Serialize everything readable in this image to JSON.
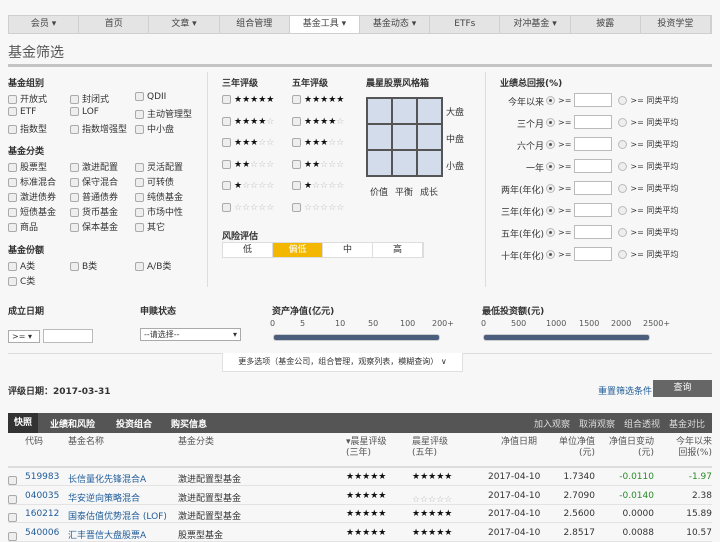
{
  "nav": {
    "items": [
      "会员 ▾",
      "首页",
      "文章 ▾",
      "组合管理",
      "基金工具 ▾",
      "基金动态 ▾",
      "ETFs",
      "对冲基金 ▾",
      "披露",
      "投资学堂"
    ],
    "active": 4
  },
  "page_title": "基金筛选",
  "fund_group": {
    "title": "基金组别",
    "items": [
      "开放式",
      "封闭式",
      "QDII",
      "ETF",
      "LOF",
      "主动管理型",
      "指数型",
      "指数增强型",
      "中小盘"
    ]
  },
  "fund_category": {
    "title": "基金分类",
    "items": [
      "股票型",
      "激进配置",
      "灵活配置",
      "标准混合",
      "保守混合",
      "可转债",
      "激进债券",
      "普通债券",
      "纯债基金",
      "短债基金",
      "货币基金",
      "市场中性",
      "商品",
      "保本基金",
      "其它"
    ]
  },
  "fund_share": {
    "title": "基金份额",
    "items": [
      "A类",
      "B类",
      "A/B类",
      "C类"
    ]
  },
  "rating3": {
    "title": "三年评级",
    "ratings": [
      5,
      4,
      3,
      2,
      1,
      0
    ]
  },
  "rating5": {
    "title": "五年评级",
    "ratings": [
      5,
      4,
      3,
      2,
      1,
      0
    ]
  },
  "stylebox": {
    "title": "晨星股票风格箱",
    "rows": [
      "大盘",
      "中盘",
      "小盘"
    ],
    "cols": [
      "价值",
      "平衡",
      "成长"
    ]
  },
  "risk": {
    "title": "风险评估",
    "options": [
      "低",
      "偏低",
      "中",
      "高"
    ],
    "selected": 1
  },
  "returns": {
    "title": "业绩总回报(%)",
    "op": ">=",
    "avg": ">= 同类平均",
    "rows": [
      "今年以来",
      "三个月",
      "六个月",
      "一年",
      "两年(年化)",
      "三年(年化)",
      "五年(年化)",
      "十年(年化)"
    ]
  },
  "inception": {
    "title": "成立日期",
    "op": ">= ▾",
    "value": ""
  },
  "purchase": {
    "title": "申赎状态",
    "value": "--请选择--"
  },
  "nav_size": {
    "title": "资产净值(亿元)",
    "ticks": [
      "0",
      "5",
      "10",
      "50",
      "100",
      "200+"
    ],
    "range": [
      "0",
      "200+"
    ]
  },
  "min_invest": {
    "title": "最低投资额(元)",
    "ticks": [
      "0",
      "500",
      "1000",
      "1500",
      "2000",
      "2500+"
    ],
    "range": [
      "0",
      "2500+"
    ]
  },
  "more_options": "更多选项（基金公司，组合管理，观察列表，模糊查询） ∨",
  "rating_date": "评级日期：2017-03-31",
  "reset": "重置筛选条件",
  "query": "查询",
  "table": {
    "tabs": [
      "快照",
      "业绩和风险",
      "投资组合",
      "购买信息"
    ],
    "actions": [
      "加入观察",
      "取消观察",
      "组合透视",
      "基金对比"
    ],
    "headers": [
      "代码",
      "基金名称",
      "基金分类",
      "▾晨星评级\n(三年)",
      "晨星评级\n(五年)",
      "净值日期",
      "单位净值\n(元)",
      "净值日变动\n(元)",
      "今年以来\n回报(%)"
    ],
    "rows": [
      {
        "code": "519983",
        "name": "长信量化先锋混合A",
        "cat": "激进配置型基金",
        "r3": 5,
        "r5": 5,
        "date": "2017-04-10",
        "nav": "1.7340",
        "chg": "-0.0110",
        "ytd": "-1.97"
      },
      {
        "code": "040035",
        "name": "华安逆向策略混合",
        "cat": "激进配置型基金",
        "r3": 5,
        "r5": 0,
        "date": "2017-04-10",
        "nav": "2.7090",
        "chg": "-0.0140",
        "ytd": "2.38"
      },
      {
        "code": "160212",
        "name": "国泰估值优势混合 (LOF)",
        "cat": "激进配置型基金",
        "r3": 5,
        "r5": 5,
        "date": "2017-04-10",
        "nav": "2.5600",
        "chg": "0.0000",
        "ytd": "15.89"
      },
      {
        "code": "540006",
        "name": "汇丰晋信大盘股票A",
        "cat": "股票型基金",
        "r3": 5,
        "r5": 5,
        "date": "2017-04-10",
        "nav": "2.8517",
        "chg": "0.0088",
        "ytd": "10.57"
      }
    ]
  },
  "colors": {
    "accent": "#f3b700",
    "link": "#1f5c99",
    "down": "#2a8a2a",
    "bar": "#4b5e7e"
  }
}
